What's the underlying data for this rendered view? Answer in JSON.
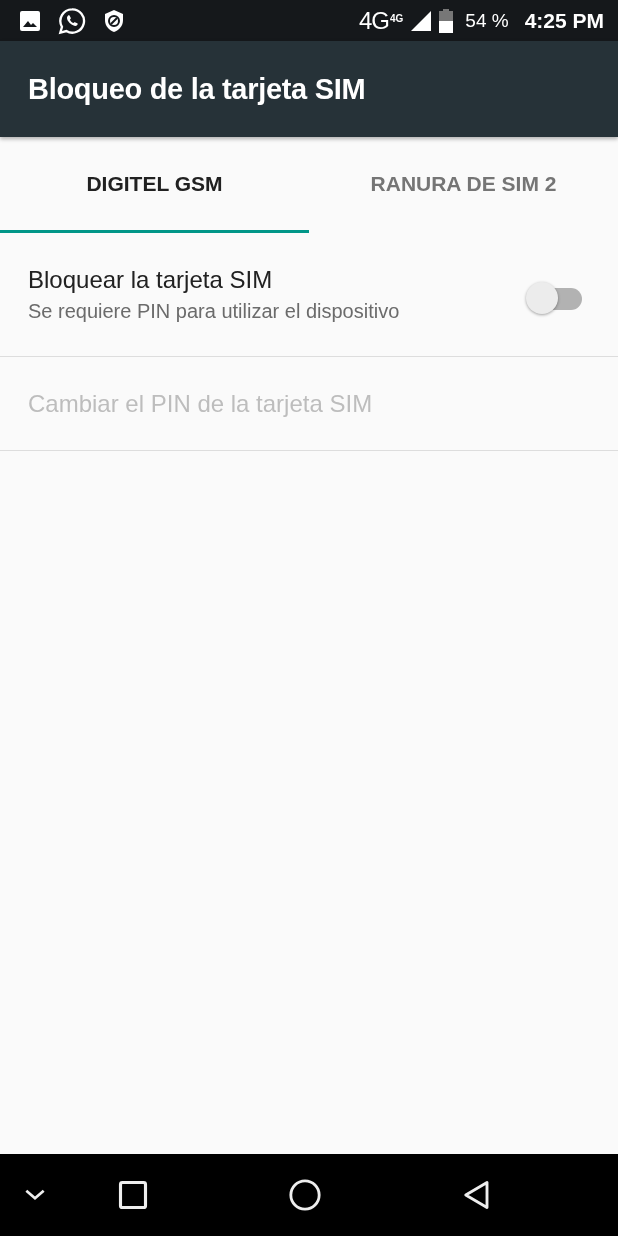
{
  "status_bar": {
    "network": "4G",
    "network_small": "4G",
    "battery_percent": "54 %",
    "time": "4:25 PM"
  },
  "app_bar": {
    "title": "Bloqueo de la tarjeta SIM"
  },
  "tabs": [
    {
      "label": "DIGITEL GSM",
      "selected": true
    },
    {
      "label": "RANURA DE SIM 2",
      "selected": false
    }
  ],
  "settings": [
    {
      "kind": "switch",
      "title": "Bloquear la tarjeta SIM",
      "summary": "Se requiere PIN para utilizar el dispositivo",
      "on": false,
      "disabled": false
    },
    {
      "kind": "plain",
      "title": "Cambiar el PIN de la tarjeta SIM",
      "disabled": true
    }
  ]
}
